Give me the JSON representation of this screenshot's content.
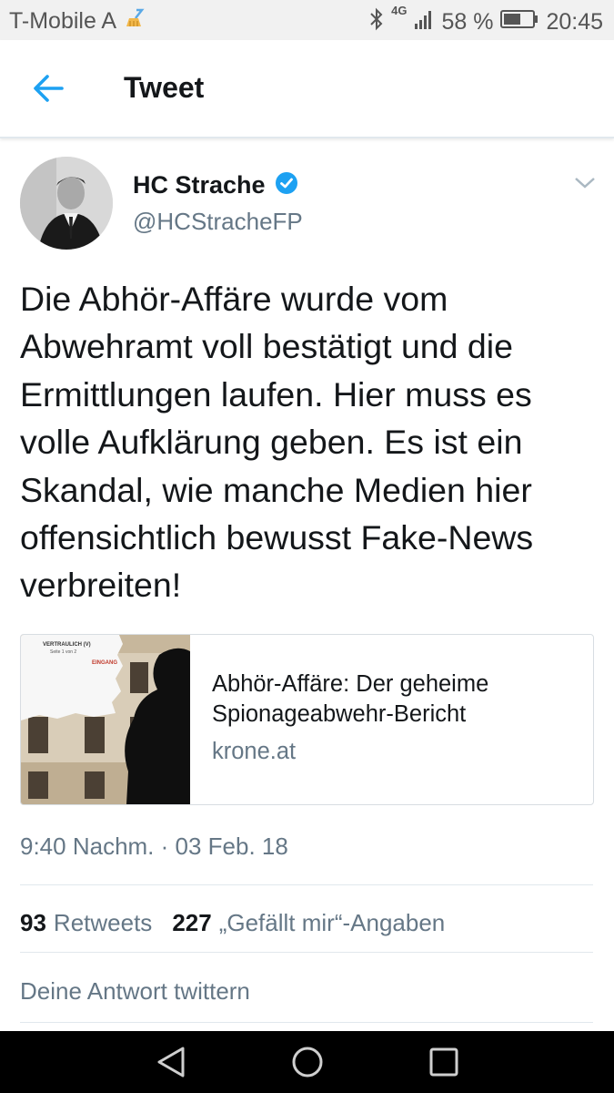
{
  "status": {
    "carrier": "T-Mobile A",
    "network": "4G",
    "battery": "58 %",
    "time": "20:45"
  },
  "header": {
    "title": "Tweet"
  },
  "tweet": {
    "author_name": "HC Strache",
    "author_handle": "@HCStracheFP",
    "verified": true,
    "lines": [
      "Die Abhör-Affäre wurde vom",
      "Abwehramt voll bestätigt und die",
      "Ermittlungen laufen. Hier muss es",
      "volle Aufklärung geben. Es ist ein",
      "Skandal, wie manche Medien hier",
      "offensichtlich bewusst Fake-News",
      "verbreiten!"
    ],
    "card": {
      "title_line1": "Abhör-Affäre: Der geheime",
      "title_line2": "Spionageabwehr-Bericht",
      "domain": "krone.at",
      "doc_header": "VERTRAULICH (V)",
      "doc_sub": "Seite 1 von 2",
      "doc_stamp": "EINGANG"
    },
    "timestamp": "9:40 Nachm. · 03 Feb. 18",
    "retweets_count": "93",
    "retweets_label": "Retweets",
    "likes_count": "227",
    "likes_label": "„Gefällt mir“-Angaben"
  },
  "reply": {
    "placeholder": "Deine Antwort twittern"
  },
  "colors": {
    "accent": "#1da1f2",
    "text": "#14171a",
    "secondary": "#657786"
  }
}
